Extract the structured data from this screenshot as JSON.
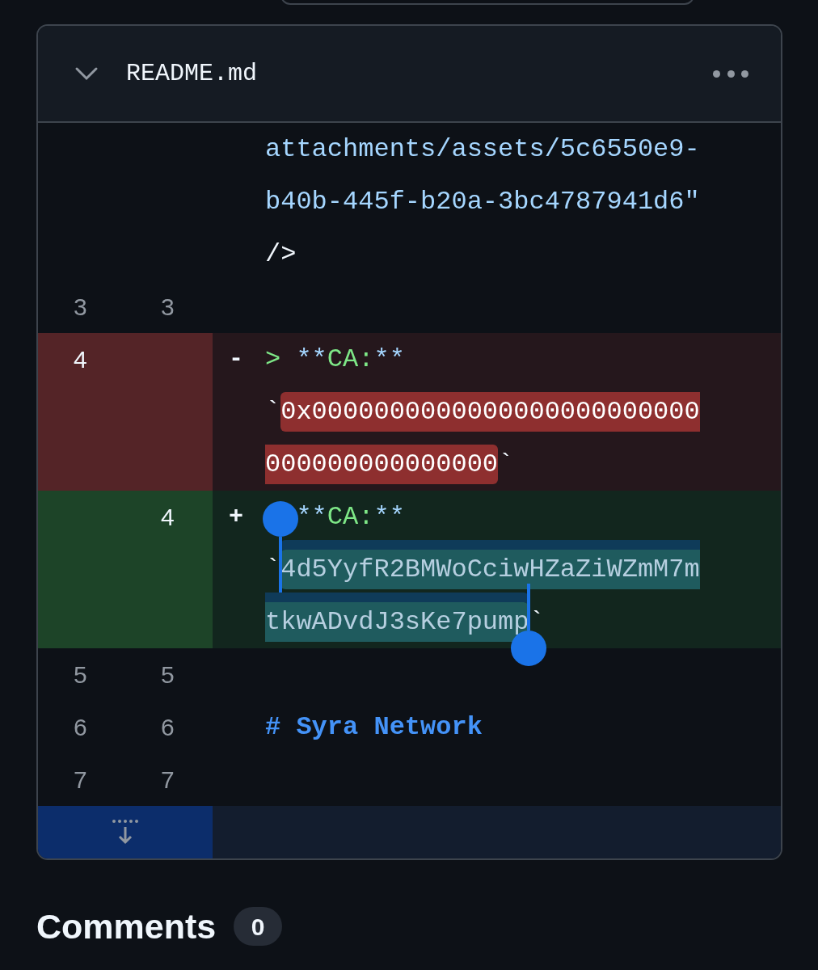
{
  "file": {
    "name": "README.md",
    "expanded": true
  },
  "lines": [
    {
      "kind": "context",
      "tokens": [
        {
          "kind": "string",
          "text": "attachments/assets/5c6550e9-b40b-445f-b20a-3bc4787941d6\""
        },
        {
          "kind": "plain",
          "text": " />"
        }
      ]
    },
    {
      "kind": "context",
      "old": "3",
      "new": "3"
    },
    {
      "kind": "deleted",
      "old": "4",
      "sign": "-",
      "tokens": [
        {
          "kind": "quote",
          "text": ">"
        },
        {
          "kind": "string",
          "text": " **"
        },
        {
          "kind": "quote",
          "text": "CA:"
        },
        {
          "kind": "string",
          "text": "**"
        },
        {
          "kind": "plain",
          "text": " `"
        },
        {
          "kind": "changed",
          "text": "0x0000000000000000000000000000000000000000"
        },
        {
          "kind": "plain",
          "text": "`"
        }
      ]
    },
    {
      "kind": "added",
      "new": "4",
      "sign": "+",
      "tokens": [
        {
          "kind": "string",
          "text": "  **"
        },
        {
          "kind": "quote",
          "text": "CA:"
        },
        {
          "kind": "string",
          "text": "**"
        },
        {
          "kind": "plain",
          "text": " `"
        },
        {
          "kind": "changed",
          "text": "4d5YyfR2BMWoCciwHZaZiWZmM7mtkwADvdJ3sKe7pump",
          "selected": true
        },
        {
          "kind": "plain",
          "text": "`"
        }
      ]
    },
    {
      "kind": "context",
      "old": "5",
      "new": "5"
    },
    {
      "kind": "context",
      "old": "6",
      "new": "6",
      "tokens": [
        {
          "kind": "heading",
          "text": "# Syra Network"
        }
      ]
    },
    {
      "kind": "context",
      "old": "7",
      "new": "7"
    }
  ],
  "comments": {
    "title": "Comments",
    "count": "0"
  }
}
